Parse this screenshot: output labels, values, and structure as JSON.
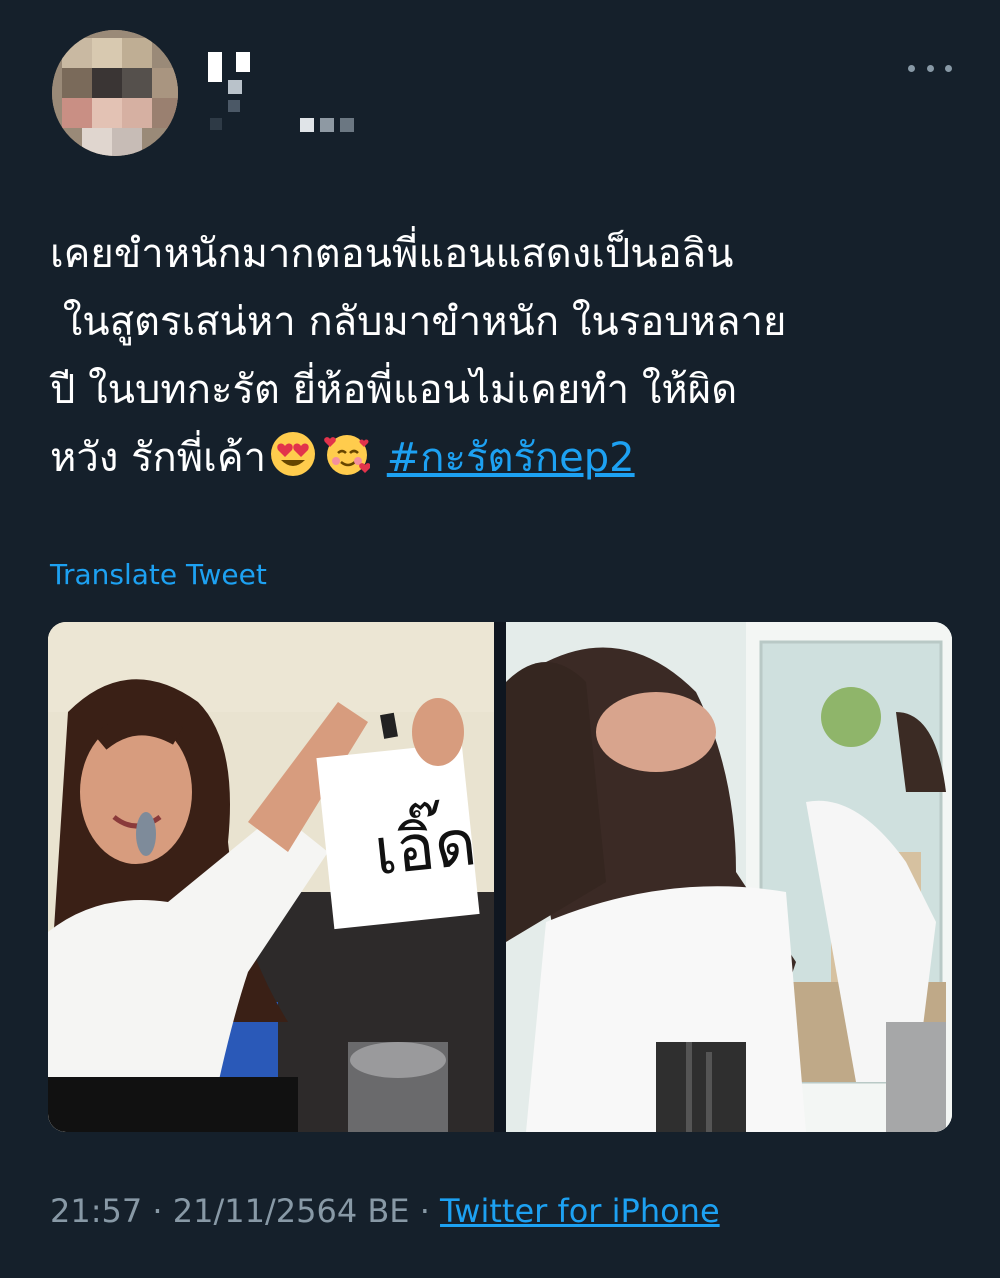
{
  "tweet": {
    "text_lines": [
      "เคยขำหนักมากตอนพี่แอนแสดงเป็นอลิน",
      " ในสูตรเสน่หา กลับมาขำหนัก ในรอบหลาย",
      "ปี ในบทกะรัต ยี่ห้อพี่แอนไม่เคยทำ ให้ผิด",
      "หวัง รักพี่เค้า"
    ],
    "emojis": [
      "smiling-face-with-heart-eyes",
      "smiling-face-with-hearts"
    ],
    "hashtag": "#กะรัตรักep2",
    "translate_label": "Translate Tweet",
    "timestamp": "21:57 · 21/11/2564 BE · ",
    "source": "Twitter for iPhone"
  },
  "media": {
    "left_photo_sign_text": "เอิ๊ด"
  },
  "colors": {
    "background": "#15202b",
    "link": "#1da1f2",
    "secondary_text": "#8899a6",
    "text": "#ffffff"
  }
}
